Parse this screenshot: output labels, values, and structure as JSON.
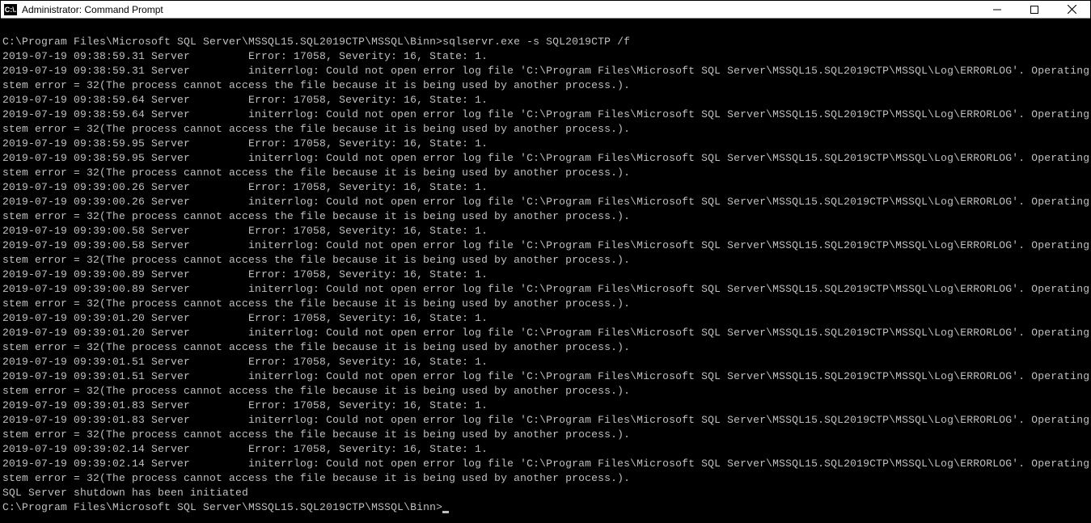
{
  "window": {
    "icon_label": "C:\\.",
    "title": "Administrator: Command Prompt",
    "minimize": "minimize",
    "maximize": "maximize",
    "close": "close"
  },
  "terminal": {
    "prompt_path": "C:\\Program Files\\Microsoft SQL Server\\MSSQL15.SQL2019CTP\\MSSQL\\Binn>",
    "command": "sqlservr.exe -s SQL2019CTP /f",
    "error_line": "Error: 17058, Severity: 16, State: 1.",
    "initerrlog_line": "initerrlog: Could not open error log file 'C:\\Program Files\\Microsoft SQL Server\\MSSQL15.SQL2019CTP\\MSSQL\\Log\\ERRORLOG'. Operating sy",
    "stem_error_line": "stem error = 32(The process cannot access the file because it is being used by another process.).",
    "source": "Server",
    "timestamps": [
      "2019-07-19 09:38:59.31",
      "2019-07-19 09:38:59.31",
      "2019-07-19 09:38:59.64",
      "2019-07-19 09:38:59.64",
      "2019-07-19 09:38:59.95",
      "2019-07-19 09:38:59.95",
      "2019-07-19 09:39:00.26",
      "2019-07-19 09:39:00.26",
      "2019-07-19 09:39:00.58",
      "2019-07-19 09:39:00.58",
      "2019-07-19 09:39:00.89",
      "2019-07-19 09:39:00.89",
      "2019-07-19 09:39:01.20",
      "2019-07-19 09:39:01.20",
      "2019-07-19 09:39:01.51",
      "2019-07-19 09:39:01.51",
      "2019-07-19 09:39:01.83",
      "2019-07-19 09:39:01.83",
      "2019-07-19 09:39:02.14",
      "2019-07-19 09:39:02.14"
    ],
    "shutdown_line": "SQL Server shutdown has been initiated",
    "final_prompt": "C:\\Program Files\\Microsoft SQL Server\\MSSQL15.SQL2019CTP\\MSSQL\\Binn>"
  }
}
